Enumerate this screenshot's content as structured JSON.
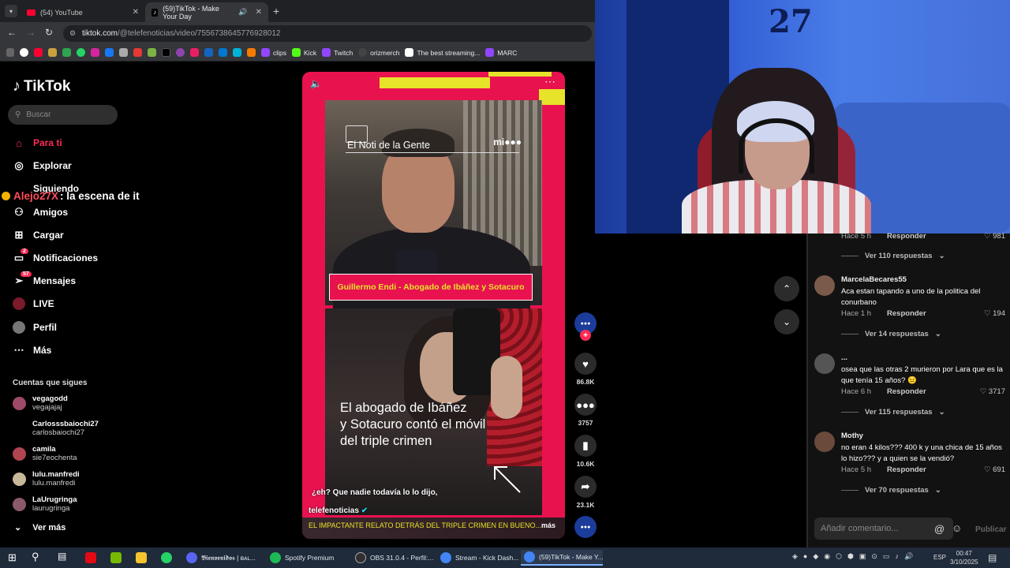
{
  "browser": {
    "tabs": [
      {
        "title": "(54) YouTube",
        "icon": "youtube-icon"
      },
      {
        "title": "(59)TikTok - Make Your Day",
        "icon": "tiktok-icon"
      }
    ],
    "url_host": "tiktok.com",
    "url_path": "/@telefenoticias/video/7556738645776928012",
    "bookmarks": [
      "clips",
      "Kick",
      "Twitch",
      "orizmerch",
      "The best streaming...",
      "MARC"
    ]
  },
  "tiktok": {
    "logo": "TikTok",
    "search_placeholder": "Buscar",
    "nav": {
      "para_ti": "Para ti",
      "explorar": "Explorar",
      "siguiendo": "Siguiendo",
      "amigos": "Amigos",
      "cargar": "Cargar",
      "notificaciones": "Notificaciones",
      "notificaciones_badge": "2",
      "mensajes": "Mensajes",
      "mensajes_badge": "57",
      "live": "LIVE",
      "perfil": "Perfil",
      "mas": "Más"
    },
    "following_title": "Cuentas que sigues",
    "following": [
      {
        "name": "vegagodd",
        "handle": "vegajajaj"
      },
      {
        "name": "Carlosssbaiochi27",
        "handle": "carlosbaiochi27"
      },
      {
        "name": "camila",
        "handle": "sie7eochenta"
      },
      {
        "name": "lulu.manfredi",
        "handle": "lulu.manfredi"
      },
      {
        "name": "LaUrugringa",
        "handle": "laurugringa"
      }
    ],
    "ver_mas": "Ver más"
  },
  "chat_overlay": {
    "user": "Alejo27X",
    "message": ": la escena de it"
  },
  "video": {
    "source_tag": "El Noti de la Gente",
    "brand": "mi●●●",
    "lower_third": "Guillermo Endi - Abogado de Ibáñez y Sotacuro",
    "headline_1": "El abogado de Ibáñez",
    "headline_2": "y Sotacuro contó el móvil",
    "headline_3": "del triple crimen",
    "caption": "¿eh? Que nadie todavía lo lo dijo,",
    "author": "telefenoticias",
    "description": "EL IMPACTANTE RELATO DETRÁS DEL TRIPLE CRIMEN EN BUENO...",
    "more": "más",
    "likes": "86.8K",
    "comments": "3757",
    "saves": "10.6K",
    "shares": "23.1K"
  },
  "comments": {
    "top_meta": {
      "time": "Hace 5 h",
      "reply": "Responder",
      "likes": "981"
    },
    "top_replies": "Ver 110 respuestas",
    "items": [
      {
        "user": "MarcelaBecares55",
        "text": "Aca estan tapando a uno de la politica del conurbano",
        "time": "Hace 1 h",
        "reply": "Responder",
        "likes": "194",
        "replies": "Ver 14 respuestas"
      },
      {
        "user": "...",
        "text": "osea que las otras 2 murieron por Lara que es la que tenía 15 años? 😐",
        "time": "Hace 6 h",
        "reply": "Responder",
        "likes": "3717",
        "replies": "Ver 115 respuestas"
      },
      {
        "user": "Mothy",
        "text": "no eran 4 kilos??? 400 k y una chica de 15 años lo hizo??? y a quien se la vendió?",
        "time": "Hace 5 h",
        "reply": "Responder",
        "likes": "691",
        "replies": "Ver 70 respuestas"
      }
    ],
    "input_placeholder": "Añadir comentario...",
    "publish": "Publicar"
  },
  "taskbar": {
    "items": [
      "𝕭𝖎𝖊𝖓𝖛𝖊𝖓𝖎𝖉𝖔𝖘 | ʙᴀʟ...",
      "Spotify Premium",
      "OBS 31.0.4 - Perfil:...",
      "Stream - Kick Dash...",
      "(59)TikTok - Make Y..."
    ],
    "lang": "ESP",
    "time": "00:47",
    "date": "3/10/2025"
  },
  "colors": {
    "accent": "#fe2c55",
    "video_bg": "#e8124f",
    "video_yellow": "#e7e22a"
  }
}
